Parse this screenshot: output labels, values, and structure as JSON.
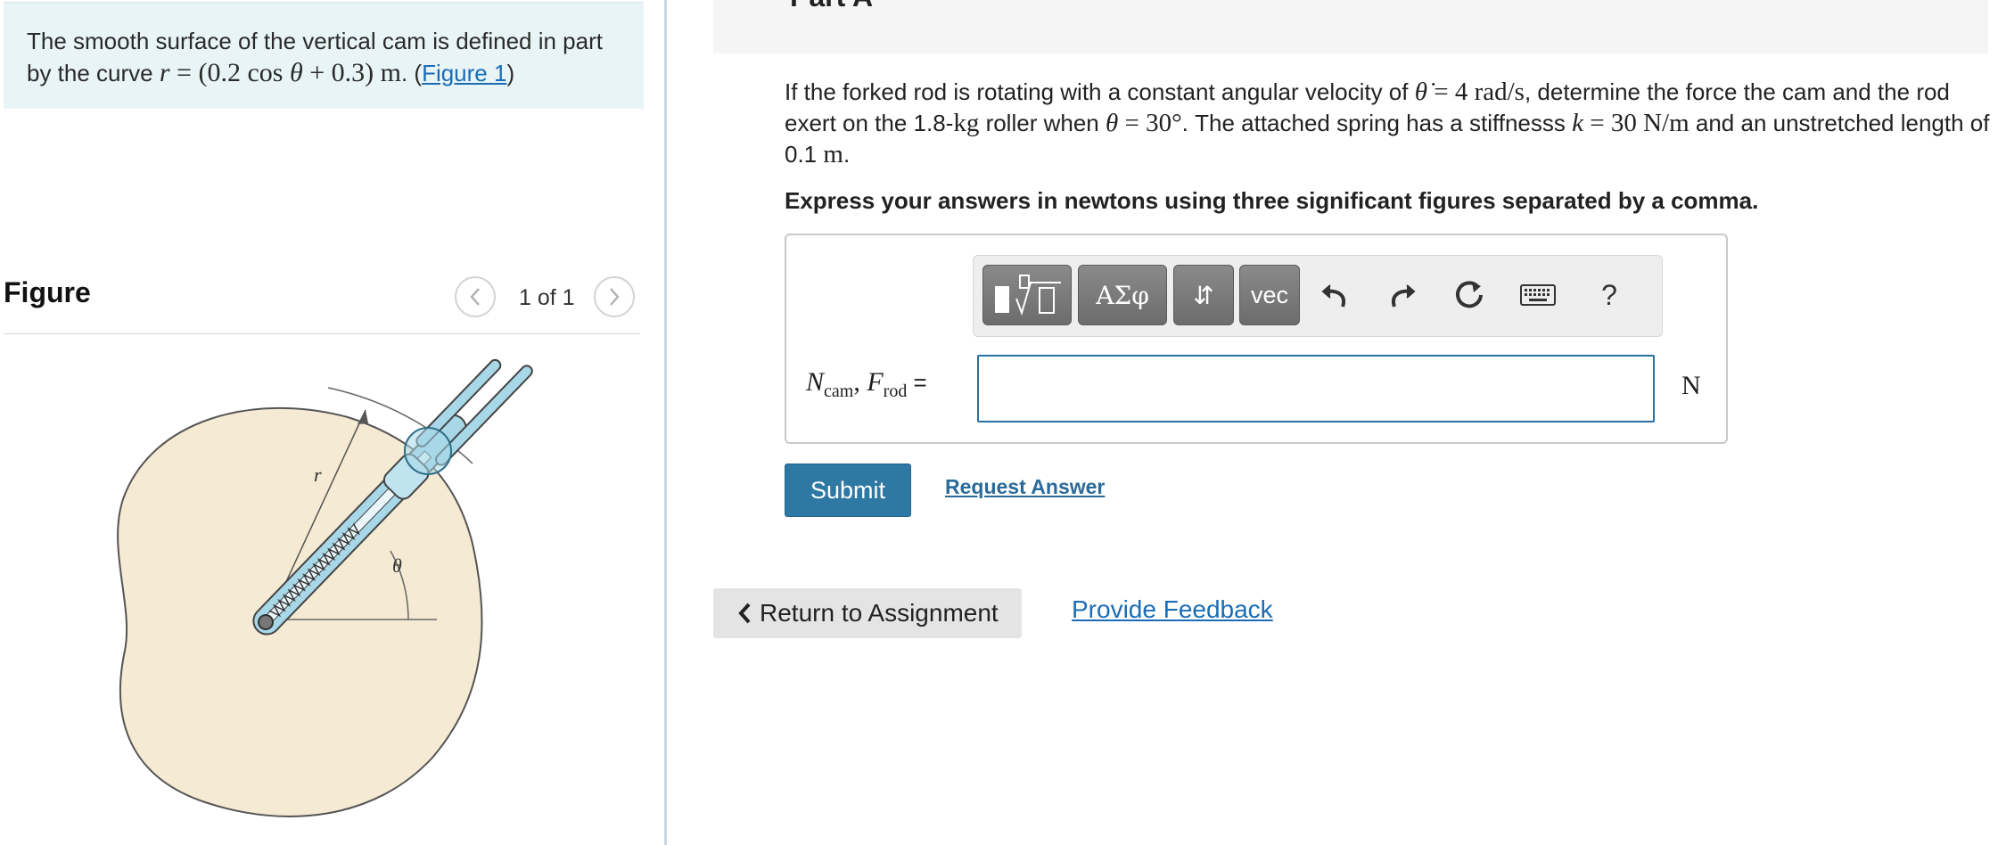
{
  "intro": {
    "text_1": "The smooth surface of the vertical cam is defined in part by the curve ",
    "math_r": "r",
    "math_eq": " = (0.2 cos ",
    "math_theta": "θ",
    "math_rest": " + 0.3) m",
    "text_2": ". (",
    "figure_link": "Figure 1",
    "text_3": ")"
  },
  "figure": {
    "title": "Figure",
    "counter": "1 of 1",
    "label_r": "r",
    "label_theta": "θ"
  },
  "part": {
    "header": "Part A"
  },
  "problem": {
    "p1": "If the forked rod is rotating with a constant angular velocity of ",
    "m_thetadot": "θ̇",
    "m_val1": " = 4 rad/s",
    "p2": ", determine the force the cam and the rod exert on the 1.8-",
    "m_kg": "kg",
    "p3": " roller when ",
    "m_theta": "θ",
    "m_val2": " = 30°",
    "p4": ". The attached spring has a stiffnesss ",
    "m_k": "k",
    "m_val3": " = 30 N/m",
    "p5": " and an unstretched length of 0.1 ",
    "m_m": "m",
    "p6": "."
  },
  "instruction": "Express your answers in newtons using three significant figures separated by a comma.",
  "toolbar": {
    "greek_label": "ΑΣφ",
    "arrows_label": "⇵",
    "vec_label": "vec",
    "help_label": "?"
  },
  "answer": {
    "label_n": "N",
    "label_n_sub": "cam",
    "sep": ", ",
    "label_f": "F",
    "label_f_sub": "rod",
    "equals": " =",
    "value": "",
    "unit": "N"
  },
  "actions": {
    "submit": "Submit",
    "request_answer": "Request Answer",
    "return": "Return to Assignment",
    "feedback": "Provide Feedback"
  },
  "colors": {
    "intro_bg": "#e8f4f6",
    "cam_fill": "#f5ead3",
    "rod_fill": "#a8d8e8",
    "submit_bg": "#2e78a4",
    "link": "#1a6db5"
  }
}
